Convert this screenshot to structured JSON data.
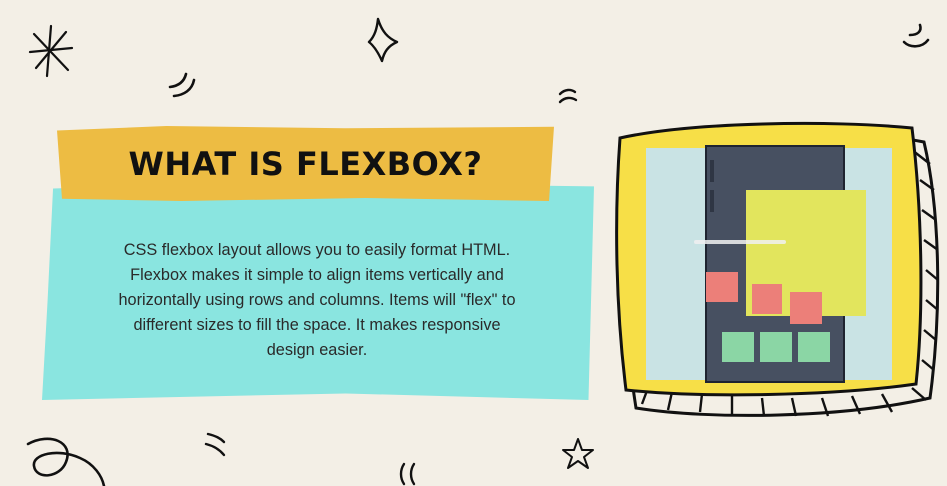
{
  "slide": {
    "title": "WHAT IS FLEXBOX?",
    "description": "CSS flexbox layout allows you to easily format HTML. Flexbox makes it simple to align items vertically and horizontally using rows and columns. Items will \"flex\" to different sizes to fill the space. It makes responsive design easier."
  },
  "colors": {
    "background": "#f3efe6",
    "title_band": "#edbc43",
    "text_band": "#8ae5e0",
    "frame_yellow": "#f7df47",
    "screen_bg": "#c9e3e4",
    "phone_dark": "#475061",
    "panel_yellow": "#e2e55d",
    "salmon": "#ec7f79",
    "green": "#8bd6a5"
  },
  "icons": [
    "asterisk-doodle",
    "diamond-doodle",
    "star-doodle",
    "squiggle-doodle"
  ]
}
